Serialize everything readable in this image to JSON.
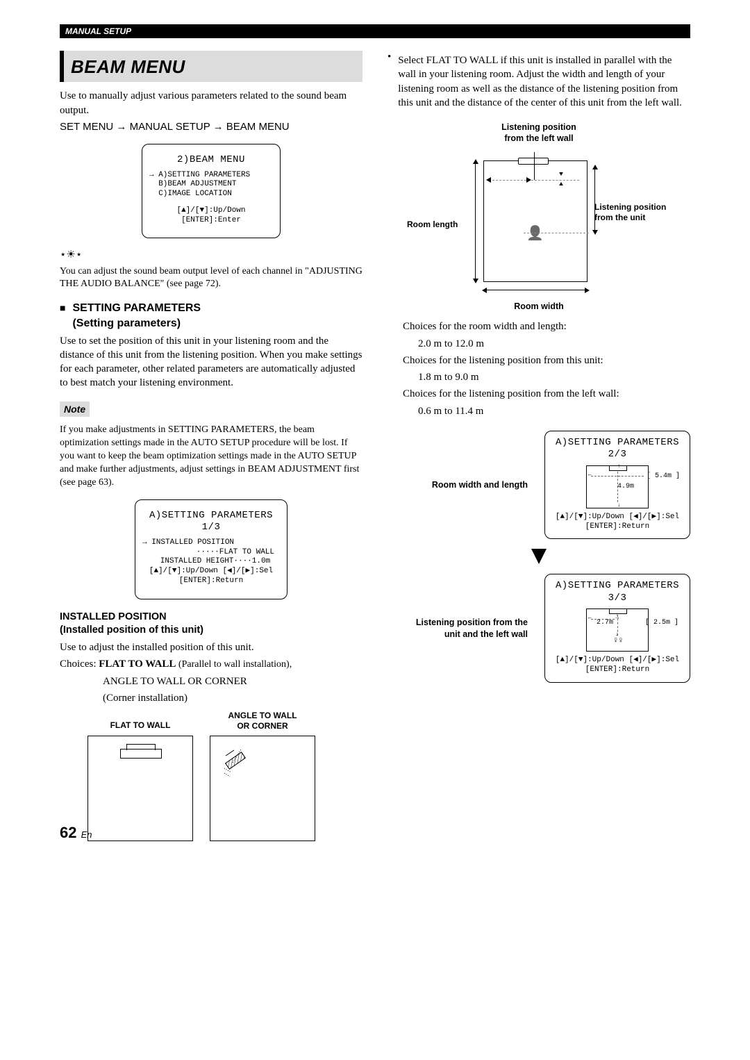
{
  "header": {
    "section": "MANUAL SETUP"
  },
  "title": {
    "main": "BEAM MENU"
  },
  "intro": {
    "p1": "Use to manually adjust various parameters related to the sound beam output.",
    "path": "SET MENU → MANUAL SETUP → BEAM MENU"
  },
  "osd1": {
    "title": "2)BEAM MENU",
    "l1": "→ A)SETTING PARAMETERS",
    "l2": "  B)BEAM ADJUSTMENT",
    "l3": "  C)IMAGE LOCATION",
    "hint1": "[▲]/[▼]:Up/Down",
    "hint2": "[ENTER]:Enter"
  },
  "tip": {
    "text": "You can adjust the sound beam output level of each channel in \"ADJUSTING THE AUDIO BALANCE\" (see page 72)."
  },
  "settingParams": {
    "heading": "SETTING PARAMETERS",
    "sub": "(Setting parameters)",
    "p1": "Use to set the position of this unit in your listening room and the distance of this unit from the listening position. When you make settings for each parameter, other related parameters are automatically adjusted to best match your listening environment."
  },
  "note": {
    "label": "Note",
    "text": "If you make adjustments in SETTING PARAMETERS, the beam optimization settings made in the AUTO SETUP procedure will be lost. If you want to keep the beam optimization settings made in the AUTO SETUP and make further adjustments, adjust settings in BEAM ADJUSTMENT first (see page 63)."
  },
  "osd2": {
    "title": "A)SETTING PARAMETERS 1/3",
    "l1": "→ INSTALLED POSITION",
    "l2": "·····FLAT TO WALL",
    "l3": "INSTALLED HEIGHT····1.0m",
    "hint1": "[▲]/[▼]:Up/Down [◀]/[▶]:Sel",
    "hint2": "[ENTER]:Return"
  },
  "installed": {
    "heading": "INSTALLED POSITION",
    "sub": "(Installed position of this unit)",
    "p1": "Use to adjust the installed position of this unit.",
    "choices_label": "Choices: ",
    "choice1_bold": "FLAT TO WALL",
    "choice1_rest": " (Parallel to wall installation),",
    "choice2": "ANGLE TO WALL OR CORNER",
    "choice3": "(Corner installation)",
    "fig1_label": "FLAT TO WALL",
    "fig2_label_l1": "ANGLE TO WALL",
    "fig2_label_l2": "OR CORNER"
  },
  "rightCol": {
    "bullet": "Select FLAT TO WALL if this unit is installed in parallel with the wall in your listening room. Adjust the width and length of your listening room as well as the distance of the listening position from this unit and the distance of the center of this unit from the left wall.",
    "labels": {
      "lp_left": "Listening position\nfrom the left wall",
      "lp_unit": "Listening position\nfrom the unit",
      "room_length": "Room length",
      "room_width": "Room width"
    },
    "choices": {
      "l1": "Choices for the room width and length:",
      "l1v": "2.0 m to 12.0 m",
      "l2": "Choices for the listening position from this unit:",
      "l2v": "1.8 m to 9.0 m",
      "l3": "Choices for the listening position from the left wall:",
      "l3v": "0.6 m to 11.4 m"
    },
    "room_label": "Room width and length",
    "listen_label": "Listening position from the\nunit and the left wall",
    "osd3": {
      "title": "A)SETTING PARAMETERS 2/3",
      "val1": "[ 5.4m ]",
      "val2": "4.9m",
      "hint1": "[▲]/[▼]:Up/Down [◀]/[▶]:Sel",
      "hint2": "[ENTER]:Return"
    },
    "osd4": {
      "title": "A)SETTING PARAMETERS 3/3",
      "val1": "2.7m",
      "val2": "[ 2.5m ]",
      "hint1": "[▲]/[▼]:Up/Down [◀]/[▶]:Sel",
      "hint2": "[ENTER]:Return"
    }
  },
  "page": {
    "num": "62",
    "lang": "En"
  }
}
